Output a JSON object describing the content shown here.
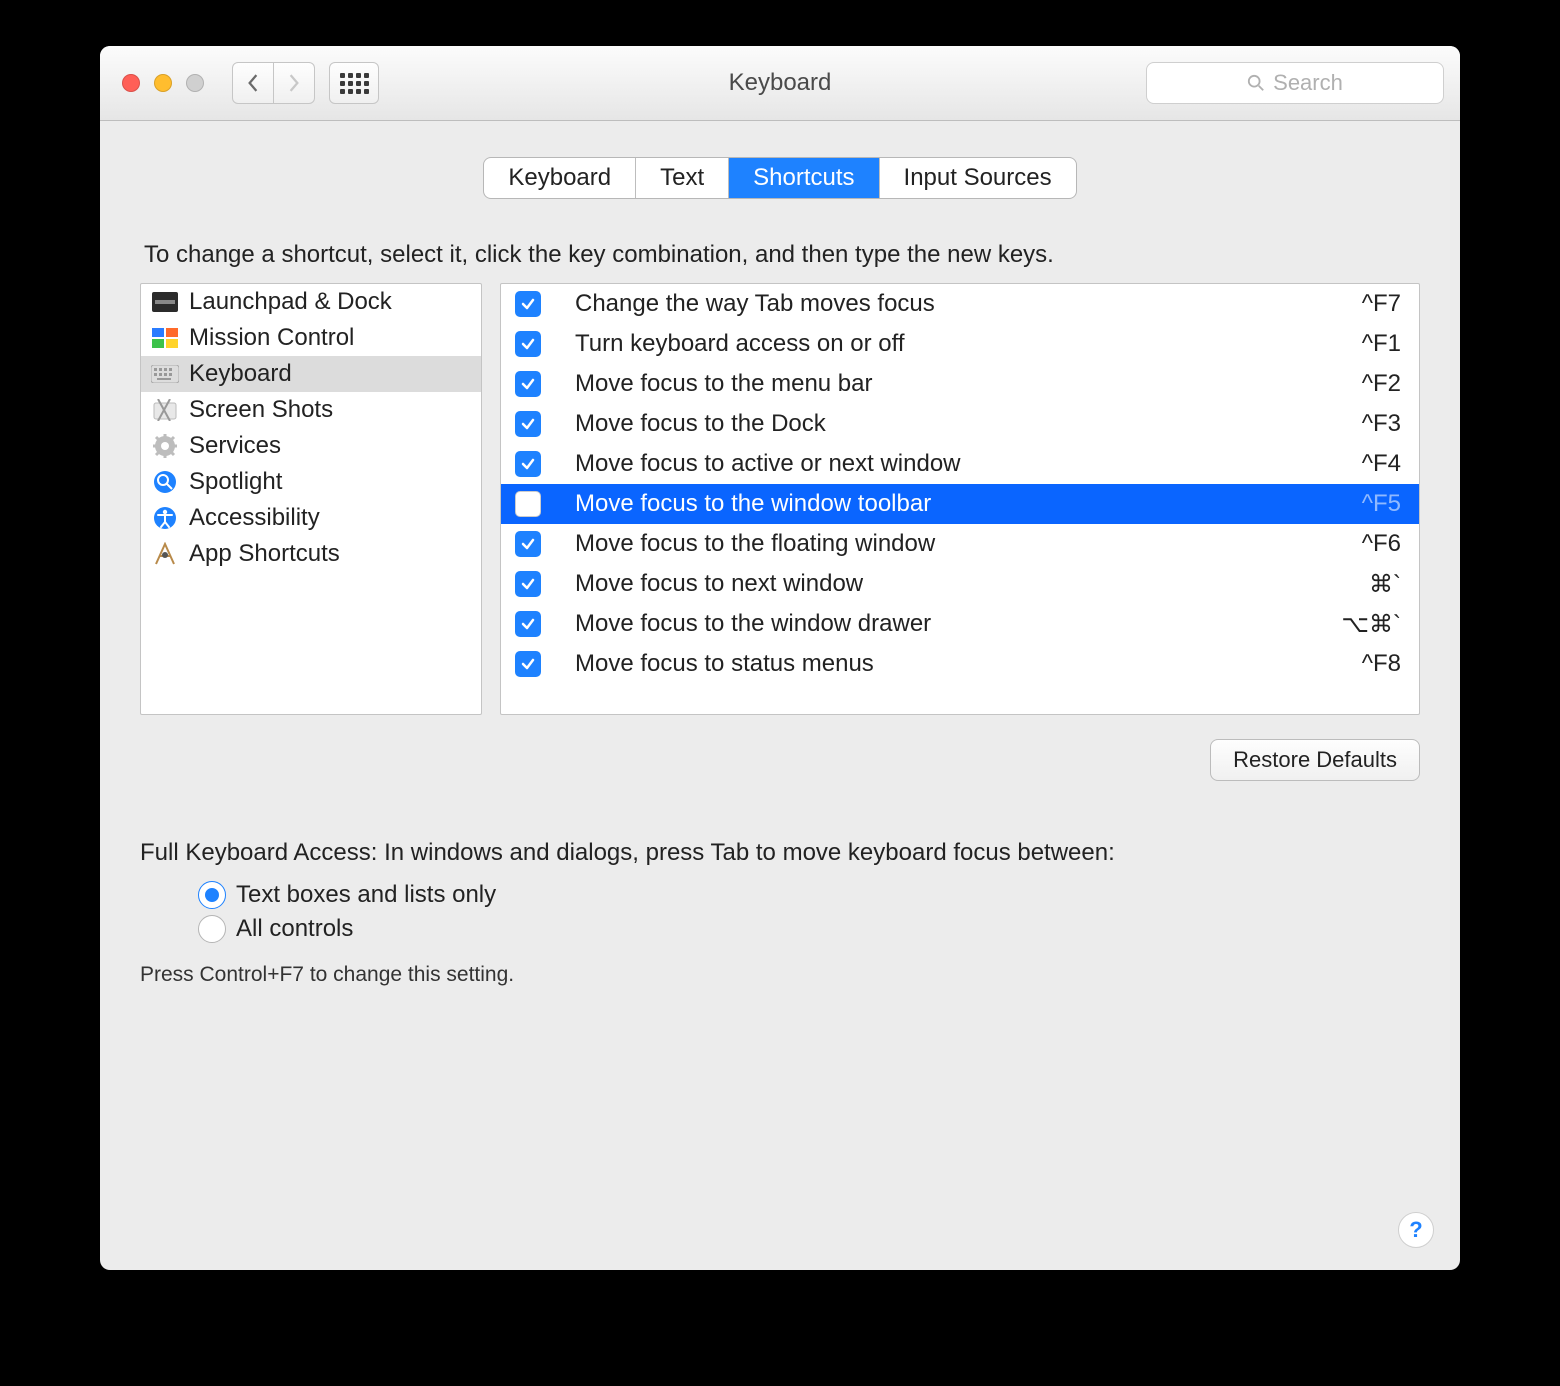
{
  "window": {
    "title": "Keyboard"
  },
  "search": {
    "placeholder": "Search"
  },
  "tabs": [
    {
      "label": "Keyboard",
      "active": false
    },
    {
      "label": "Text",
      "active": false
    },
    {
      "label": "Shortcuts",
      "active": true
    },
    {
      "label": "Input Sources",
      "active": false
    }
  ],
  "instruction": "To change a shortcut, select it, click the key combination, and then type the new keys.",
  "categories": [
    {
      "label": "Launchpad & Dock",
      "selected": false,
      "icon": "launchpad-icon"
    },
    {
      "label": "Mission Control",
      "selected": false,
      "icon": "mission-control-icon"
    },
    {
      "label": "Keyboard",
      "selected": true,
      "icon": "keyboard-icon"
    },
    {
      "label": "Screen Shots",
      "selected": false,
      "icon": "screenshots-icon"
    },
    {
      "label": "Services",
      "selected": false,
      "icon": "services-icon"
    },
    {
      "label": "Spotlight",
      "selected": false,
      "icon": "spotlight-icon"
    },
    {
      "label": "Accessibility",
      "selected": false,
      "icon": "accessibility-icon"
    },
    {
      "label": "App Shortcuts",
      "selected": false,
      "icon": "app-shortcuts-icon"
    }
  ],
  "shortcuts": [
    {
      "checked": true,
      "label": "Change the way Tab moves focus",
      "key": "^F7",
      "selected": false
    },
    {
      "checked": true,
      "label": "Turn keyboard access on or off",
      "key": "^F1",
      "selected": false
    },
    {
      "checked": true,
      "label": "Move focus to the menu bar",
      "key": "^F2",
      "selected": false
    },
    {
      "checked": true,
      "label": "Move focus to the Dock",
      "key": "^F3",
      "selected": false
    },
    {
      "checked": true,
      "label": "Move focus to active or next window",
      "key": "^F4",
      "selected": false
    },
    {
      "checked": false,
      "label": "Move focus to the window toolbar",
      "key": "^F5",
      "selected": true
    },
    {
      "checked": true,
      "label": "Move focus to the floating window",
      "key": "^F6",
      "selected": false
    },
    {
      "checked": true,
      "label": "Move focus to next window",
      "key": "⌘`",
      "selected": false
    },
    {
      "checked": true,
      "label": "Move focus to the window drawer",
      "key": "⌥⌘`",
      "selected": false
    },
    {
      "checked": true,
      "label": "Move focus to status menus",
      "key": "^F8",
      "selected": false
    }
  ],
  "restore_defaults": "Restore Defaults",
  "full_keyboard_access": {
    "heading": "Full Keyboard Access: In windows and dialogs, press Tab to move keyboard focus between:",
    "options": [
      {
        "label": "Text boxes and lists only",
        "selected": true
      },
      {
        "label": "All controls",
        "selected": false
      }
    ],
    "hint": "Press Control+F7 to change this setting."
  },
  "help_label": "?"
}
